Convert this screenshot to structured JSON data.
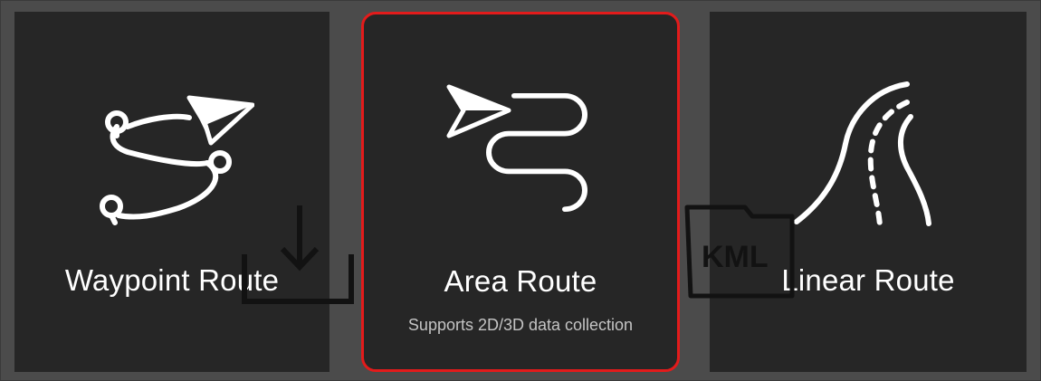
{
  "route_options": {
    "waypoint": {
      "title": "Waypoint Route",
      "icon": "waypoint-route-icon"
    },
    "area": {
      "title": "Area Route",
      "subtitle": "Supports 2D/3D data collection",
      "icon": "area-route-icon",
      "selected": true
    },
    "linear": {
      "title": "Linear Route",
      "icon": "linear-route-icon"
    }
  },
  "ghost_overlays": {
    "import_icon": "download-tray-icon",
    "kml_label": "KML"
  },
  "colors": {
    "background": "#4b4b4b",
    "card": "#262626",
    "selected_border": "#e31b1b",
    "text": "#ffffff",
    "subtitle": "#c4c4c4"
  }
}
